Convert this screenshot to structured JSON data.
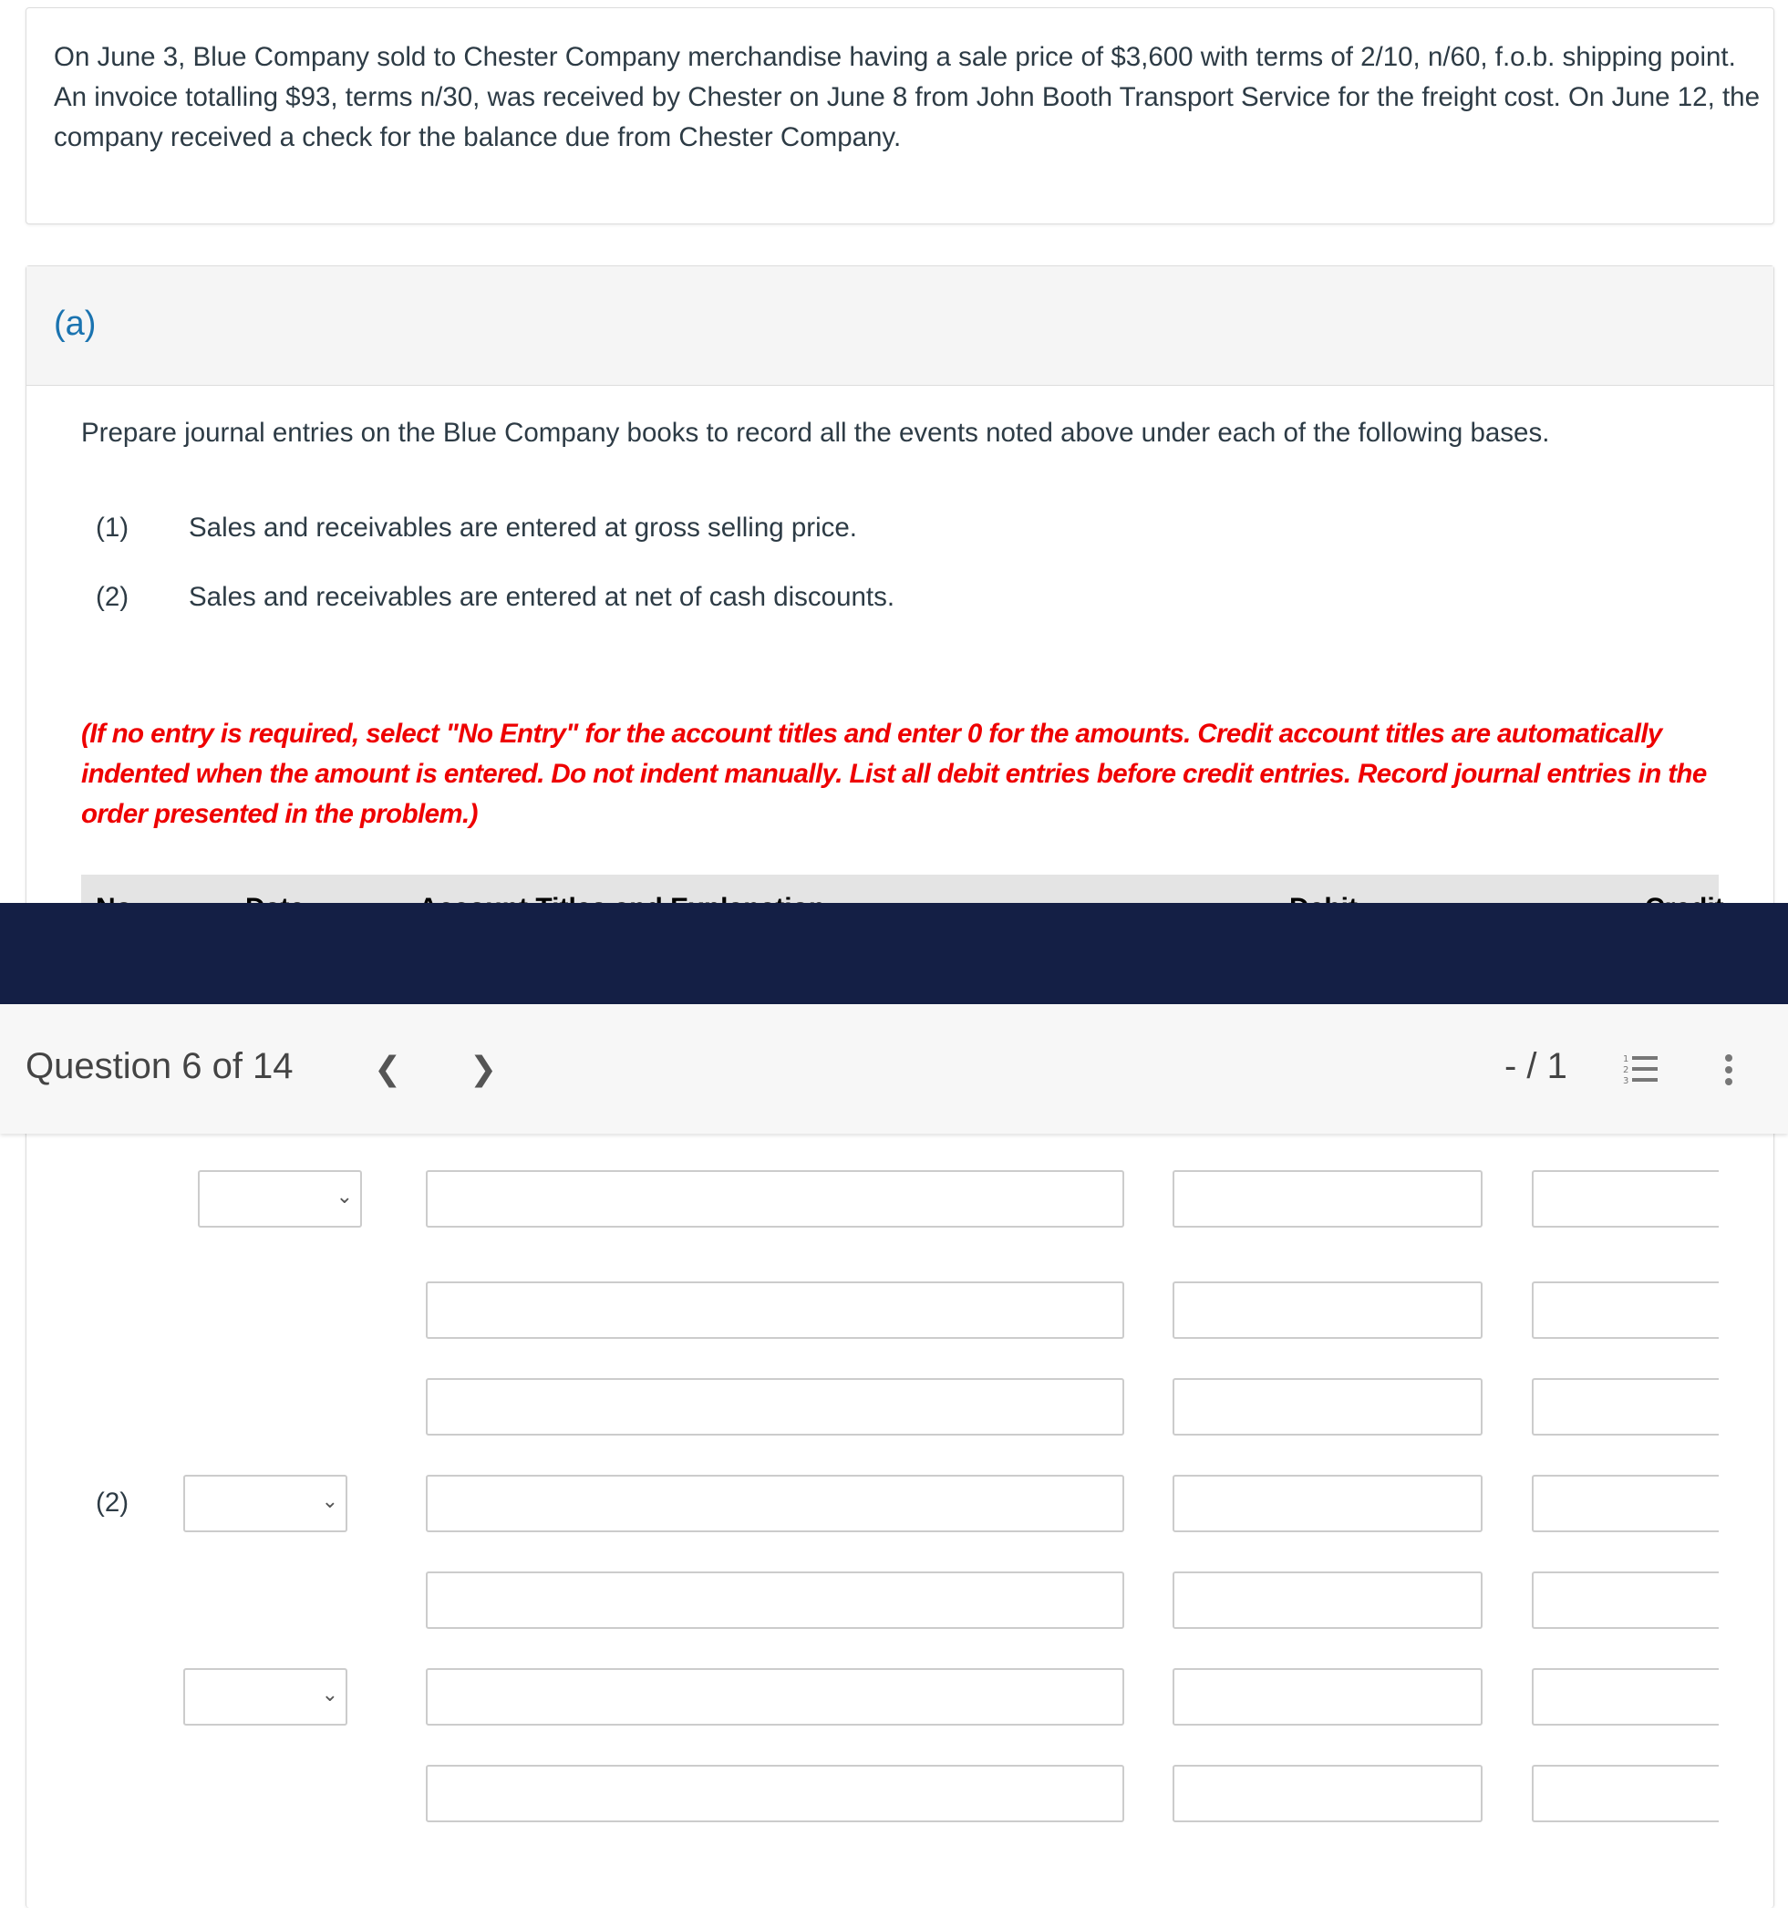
{
  "problem": {
    "text": "On June 3, Blue Company sold to Chester Company merchandise having a sale price of $3,600 with terms of 2/10, n/60, f.o.b. shipping point. An invoice totalling $93, terms n/30, was received by Chester on June 8 from John Booth Transport Service for the freight cost. On June 12, the company received a check for the balance due from Chester Company."
  },
  "part": {
    "label": "(a)",
    "instruction": "Prepare journal entries on the Blue Company books to record all the events noted above under each of the following bases.",
    "bases": [
      {
        "num": "(1)",
        "text": "Sales and receivables are entered at gross selling price."
      },
      {
        "num": "(2)",
        "text": "Sales and receivables are entered at net of cash discounts."
      }
    ],
    "note": "(If no entry is required, select \"No Entry\" for the account titles and enter 0 for the amounts. Credit account titles are automatically indented when the amount is entered. Do not indent manually. List all debit entries before credit entries. Record journal entries in the order presented in the problem.)",
    "table_headers": {
      "no": "No.",
      "date": "Date",
      "account": "Account Titles and Explanation",
      "debit": "Debit",
      "credit": "Credit"
    },
    "rows": [
      {
        "no": "",
        "date": "",
        "account": "",
        "debit": "",
        "credit": ""
      },
      {
        "no": "",
        "account": "",
        "debit": "",
        "credit": ""
      },
      {
        "no": "",
        "account": "",
        "debit": "",
        "credit": ""
      },
      {
        "no": "(2)",
        "date": "",
        "account": "",
        "debit": "",
        "credit": ""
      },
      {
        "no": "",
        "account": "",
        "debit": "",
        "credit": ""
      },
      {
        "no": "",
        "date": "",
        "account": "",
        "debit": "",
        "credit": ""
      },
      {
        "no": "",
        "account": "",
        "debit": "",
        "credit": ""
      }
    ]
  },
  "nav": {
    "title": "Question 6 of 14",
    "prev_icon": "chevron-left-icon",
    "next_icon": "chevron-right-icon",
    "score": "- / 1",
    "list_icon": "numbered-list-icon",
    "more_icon": "more-vertical-icon"
  },
  "colors": {
    "band": "#141f45",
    "accent": "#1a73b0",
    "note": "#e00000"
  }
}
